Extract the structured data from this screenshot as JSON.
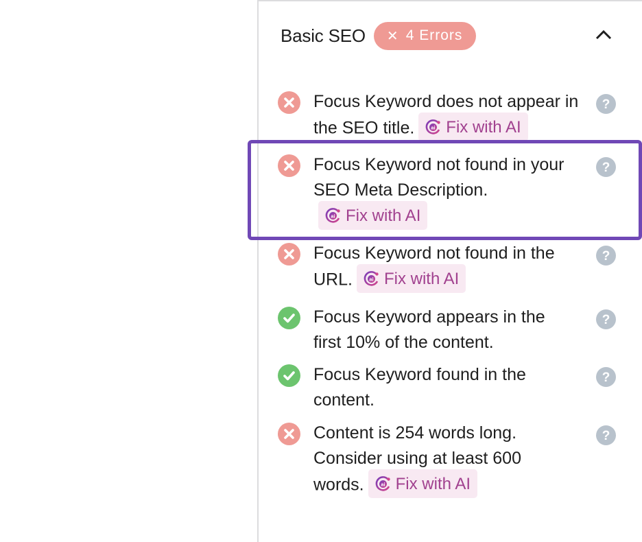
{
  "section": {
    "title": "Basic SEO",
    "badge": {
      "icon": "x-icon",
      "label": "4 Errors",
      "color": "#ef9a94"
    },
    "collapse_icon": "chevron-up-icon"
  },
  "fix_label": "Fix with AI",
  "colors": {
    "error": "#ef9a94",
    "success": "#6cc46e",
    "help": "#b8c2cc",
    "fix_bg": "#f8e9f2",
    "fix_text": "#a1418f",
    "highlight": "#7048b6"
  },
  "checks": [
    {
      "status": "error",
      "text": "Focus Keyword does not appear in the SEO title.",
      "fix": true
    },
    {
      "status": "error",
      "text": "Focus Keyword not found in your SEO Meta Description.",
      "fix": true,
      "highlighted": true
    },
    {
      "status": "error",
      "text": "Focus Keyword not found in the URL.",
      "fix": true
    },
    {
      "status": "success",
      "text": "Focus Keyword appears in the first 10% of the content.",
      "fix": false
    },
    {
      "status": "success",
      "text": "Focus Keyword found in the content.",
      "fix": false
    },
    {
      "status": "error",
      "text": "Content is 254 words long. Consider using at least 600 words.",
      "fix": true
    }
  ]
}
